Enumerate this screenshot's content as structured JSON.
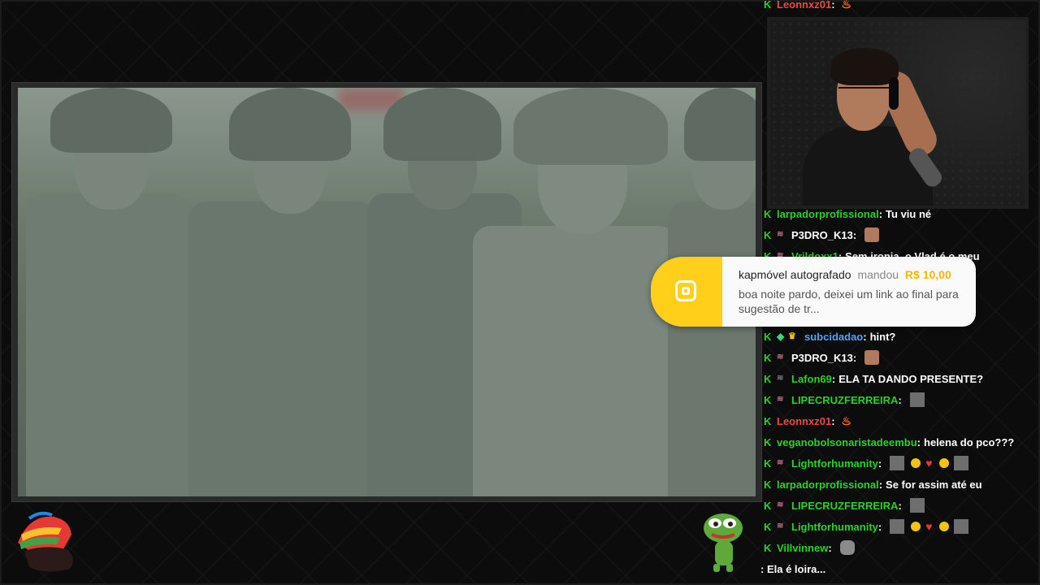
{
  "chat": {
    "top_partial": {
      "username": "Leonnxz01",
      "color": "#e84a4a"
    },
    "lines": [
      {
        "username": "larpadorprofissional",
        "color": "#2cd12c",
        "message": "Tu viu né",
        "badge": "none",
        "emotes": []
      },
      {
        "username": "P3DRO_K13",
        "color": "#ffffff",
        "message": "",
        "badge": "sub",
        "emotes": [
          "face"
        ]
      },
      {
        "username": "Vrildoxx1",
        "color": "#2cd12c",
        "message": "Sem ironia, o Vlad é o meu",
        "badge": "sub",
        "emotes": []
      },
      {
        "username": "subcidadao",
        "color": "#4fa3ff",
        "message": "hint?",
        "badge": "gem-crown",
        "emotes": []
      },
      {
        "username": "P3DRO_K13",
        "color": "#ffffff",
        "message": "",
        "badge": "sub",
        "emotes": [
          "face"
        ]
      },
      {
        "username": "Lafon69",
        "color": "#2cd12c",
        "message": "ELA TA DANDO PRESENTE?",
        "badge": "sub-gray",
        "emotes": []
      },
      {
        "username": "LIPECRUZFERREIRA",
        "color": "#2cd12c",
        "message": "",
        "badge": "sub",
        "emotes": [
          "gray"
        ]
      },
      {
        "username": "Leonnxz01",
        "color": "#e84a4a",
        "message": "",
        "badge": "none",
        "emotes": [
          "fire"
        ]
      },
      {
        "username": "veganobolsonaristadeembu",
        "color": "#2cd12c",
        "message": "helena do pco???",
        "badge": "none",
        "emotes": []
      },
      {
        "username": "Lightforhumanity",
        "color": "#2cd12c",
        "message": "",
        "badge": "sub",
        "emotes": [
          "gray",
          "sun",
          "heart",
          "sun",
          "gray"
        ]
      },
      {
        "username": "larpadorprofissional",
        "color": "#2cd12c",
        "message": "Se for assim até eu",
        "badge": "none",
        "emotes": []
      },
      {
        "username": "LIPECRUZFERREIRA",
        "color": "#2cd12c",
        "message": "",
        "badge": "sub",
        "emotes": [
          "gray"
        ]
      },
      {
        "username": "Lightforhumanity",
        "color": "#2cd12c",
        "message": "",
        "badge": "sub",
        "emotes": [
          "gray",
          "sun",
          "heart",
          "sun",
          "gray"
        ]
      },
      {
        "username": "Villvinnew",
        "color": "#2cd12c",
        "message": "",
        "badge": "none",
        "emotes": [
          "cat"
        ]
      }
    ],
    "last_line": ": Ela é loira..."
  },
  "alert": {
    "name": "kapmóvel autografado",
    "verb": "mandou",
    "amount": "R$ 10,00",
    "text": "boa noite pardo, deixei um link ao final para sugestão de tr..."
  },
  "colors": {
    "accent": "#ffcf1a",
    "kick_green": "#2cd12c"
  }
}
